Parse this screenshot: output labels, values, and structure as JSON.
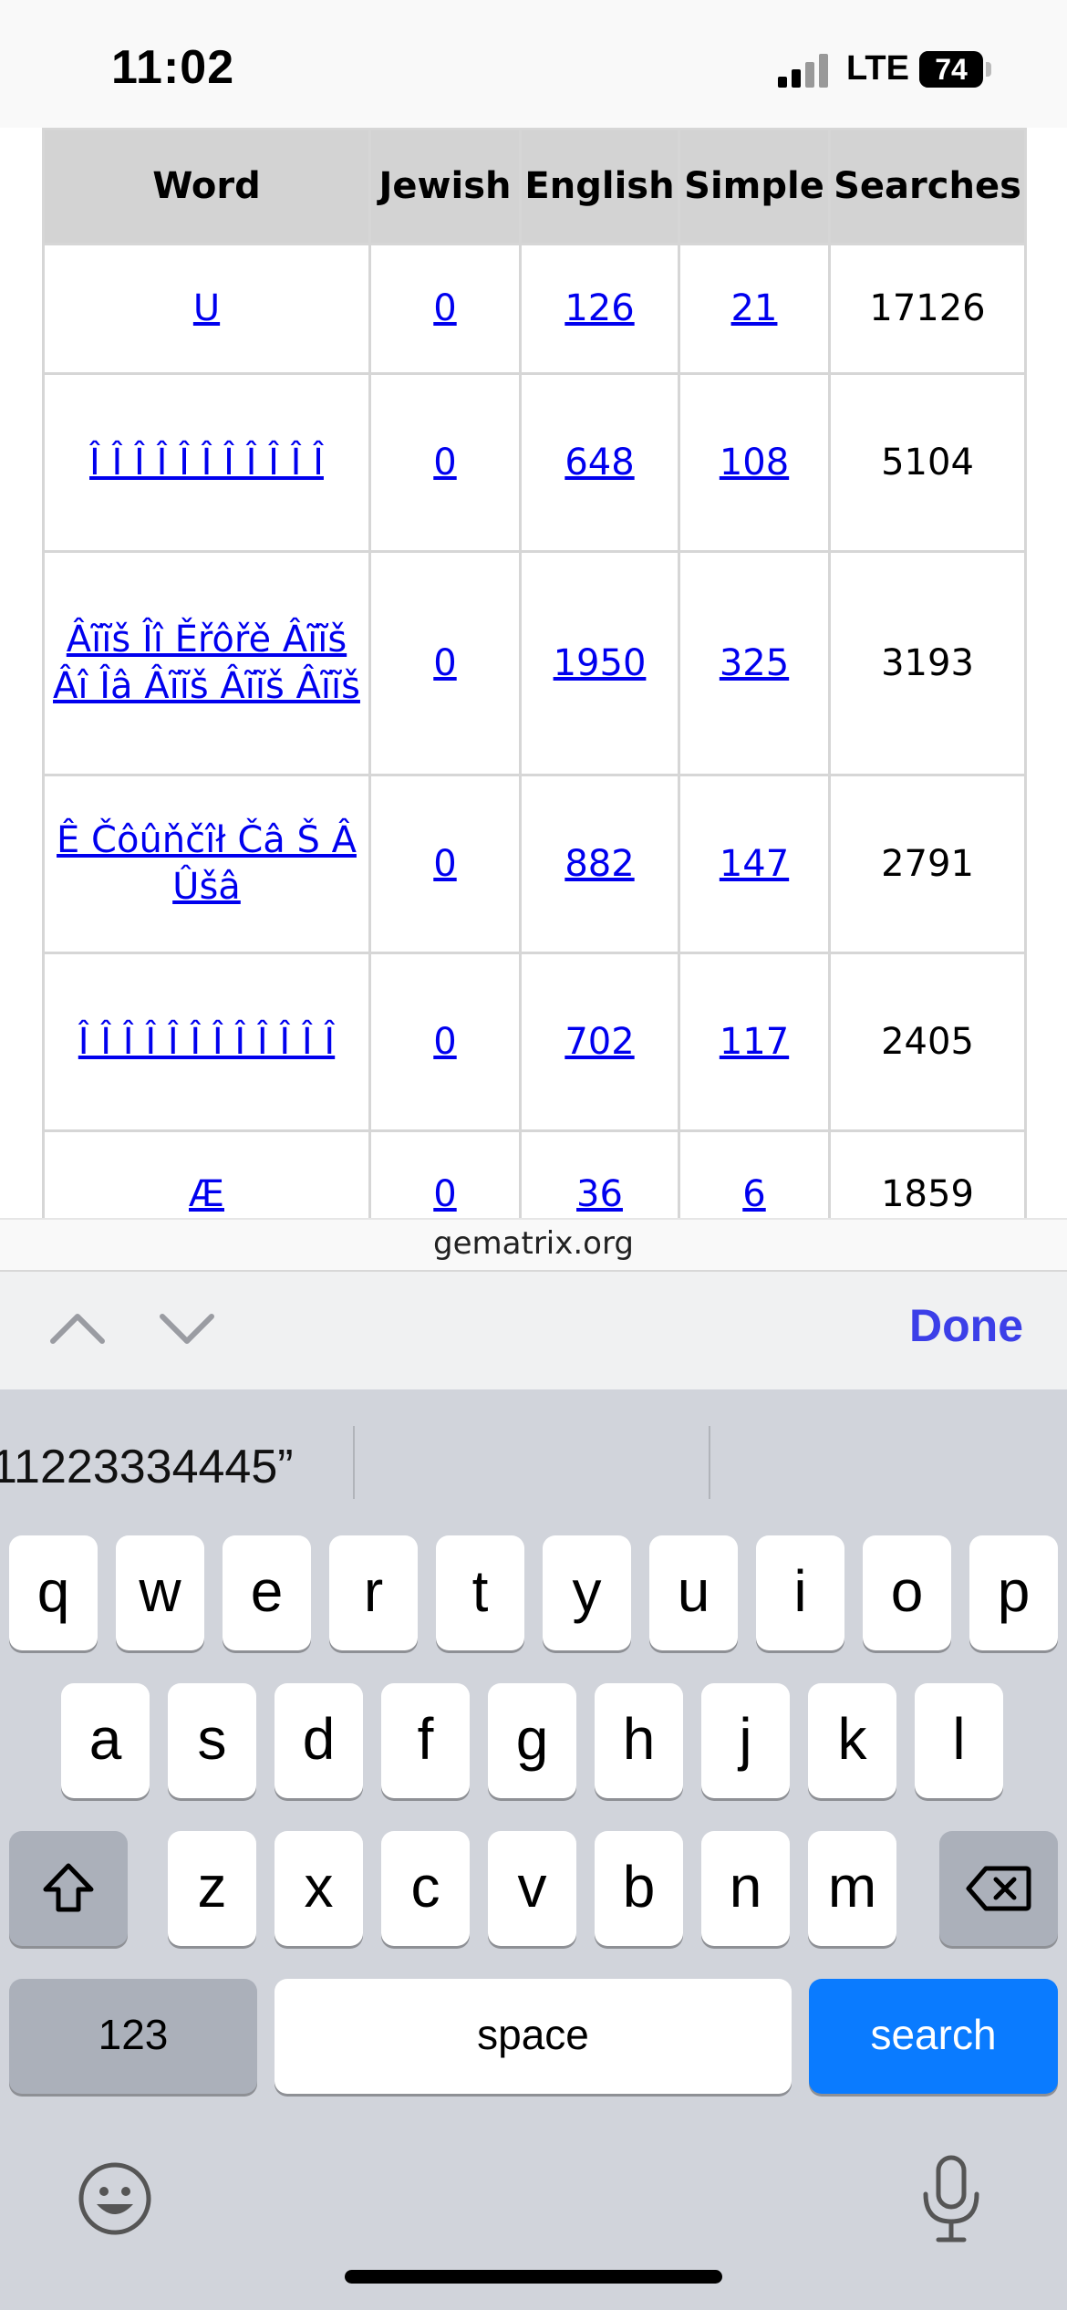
{
  "status_bar": {
    "time": "11:02",
    "network": "LTE",
    "battery": "74",
    "battery_level": 0.74
  },
  "table": {
    "headers": [
      "Word",
      "Jewish",
      "English",
      "Simple",
      "Searches"
    ],
    "rows": [
      {
        "word": "U",
        "jewish": "0",
        "english": "126",
        "simple": "21",
        "searches": "17126"
      },
      {
        "word": "Î Î Î Î Î Î Î Î Î Î Î",
        "jewish": "0",
        "english": "648",
        "simple": "108",
        "searches": "5104"
      },
      {
        "word": "Âĩĩš Îî Ěřôřě Âĩĩš Âî Îâ Âĩĩš Âĩĩš Âĩĩš",
        "jewish": "0",
        "english": "1950",
        "simple": "325",
        "searches": "3193"
      },
      {
        "word": "Ê Čôûňčîł Čâ Š Â Ûšâ",
        "jewish": "0",
        "english": "882",
        "simple": "147",
        "searches": "2791"
      },
      {
        "word": "Î Î Î Î Î Î Î Î Î Î Î Î",
        "jewish": "0",
        "english": "702",
        "simple": "117",
        "searches": "2405"
      },
      {
        "word": "Æ",
        "jewish": "0",
        "english": "36",
        "simple": "6",
        "searches": "1859"
      }
    ]
  },
  "url_bar": {
    "domain": "gematrix.org"
  },
  "accessory": {
    "done_label": "Done"
  },
  "keyboard": {
    "suggestions": [
      "11223334445”",
      "",
      ""
    ],
    "row1": [
      "q",
      "w",
      "e",
      "r",
      "t",
      "y",
      "u",
      "i",
      "o",
      "p"
    ],
    "row2": [
      "a",
      "s",
      "d",
      "f",
      "g",
      "h",
      "j",
      "k",
      "l"
    ],
    "row3": [
      "z",
      "x",
      "c",
      "v",
      "b",
      "n",
      "m"
    ],
    "numbers_label": "123",
    "space_label": "space",
    "search_label": "search"
  },
  "icons": [
    "shift-icon",
    "backspace-icon",
    "chevron-up-icon",
    "chevron-down-icon",
    "emoji-icon",
    "microphone-icon"
  ],
  "colors": {
    "link": "#0000ee",
    "done": "#3c3fe8",
    "search_key": "#0a7bff"
  }
}
